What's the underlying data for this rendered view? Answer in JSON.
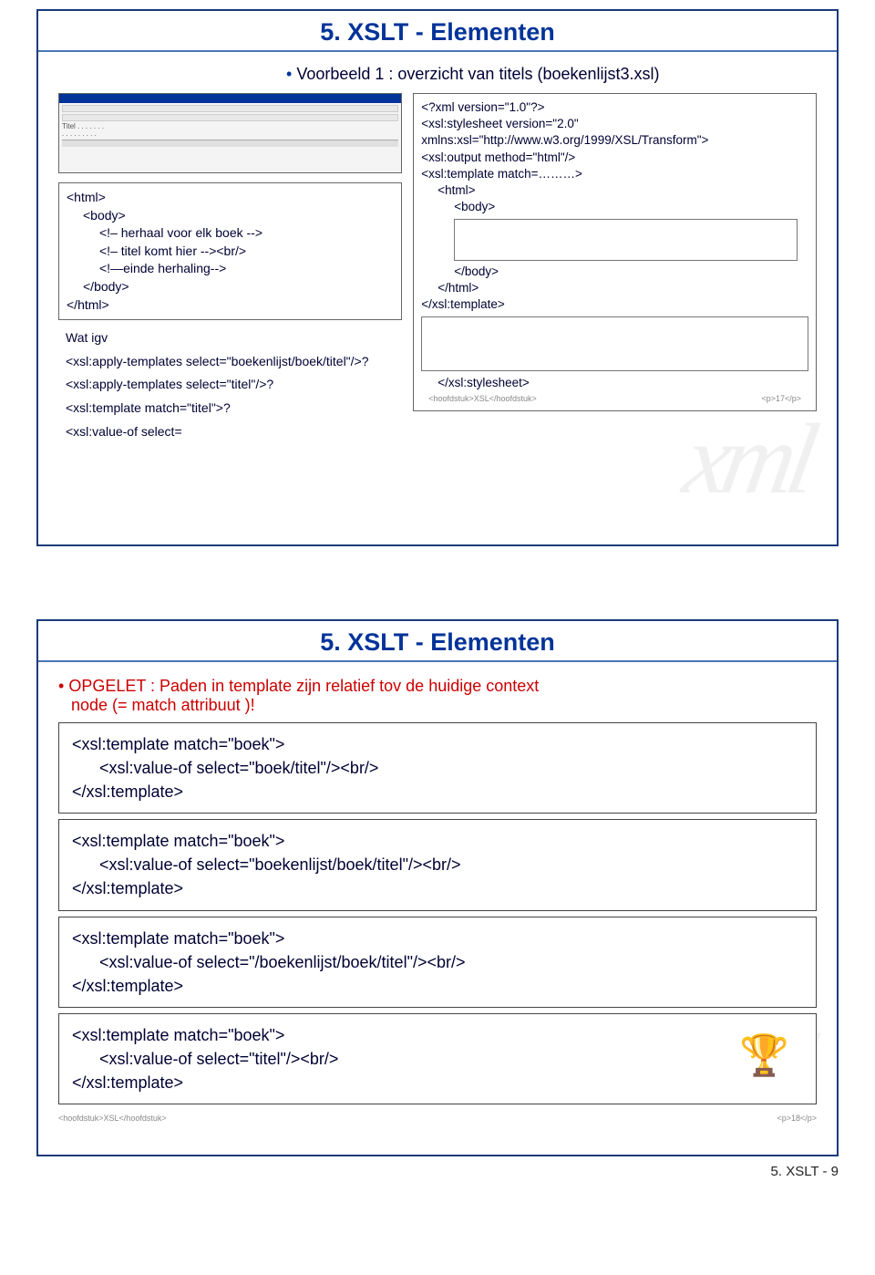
{
  "slide1": {
    "title": "5. XSLT - Elementen",
    "bullet": "Voorbeeld 1 : overzicht van titels (boekenlijst3.xsl)",
    "html_box": {
      "l1": "<html>",
      "l2": "<body>",
      "l3": "<!– herhaal voor elk boek -->",
      "l4": "<!– titel komt hier --><br/>",
      "l5": "<!—einde herhaling-->",
      "l6": "</body>",
      "l7": "</html>"
    },
    "wat_box": {
      "l1": "Wat igv",
      "l2": "<xsl:apply-templates select=\"boekenlijst/boek/titel\"/>?",
      "l3": "<xsl:apply-templates select=\"titel\"/>?",
      "l4": "<xsl:template match=\"titel\">?",
      "l5": "<xsl:value-of select="
    },
    "xsl": {
      "l1": "<?xml version=\"1.0\"?>",
      "l2": "<xsl:stylesheet version=\"2.0\" xmlns:xsl=\"http://www.w3.org/1999/XSL/Transform\">",
      "l3": "<xsl:output method=\"html\"/>",
      "l4": "<xsl:template match=………>",
      "l5": "<html>",
      "l6": "<body>",
      "l7": "</body>",
      "l8": "</html>",
      "l9": "</xsl:template>",
      "l10": "</xsl:stylesheet>"
    },
    "footer_left": "<hoofdstuk>XSL</hoofdstuk>",
    "footer_right": "<p>17</p>"
  },
  "slide2": {
    "title": "5. XSLT - Elementen",
    "warn1": "OPGELET : Paden in template zijn relatief tov de huidige context",
    "warn2": "node (= match attribuut )!",
    "block1": {
      "l1": "<xsl:template match=\"boek\">",
      "l2": "<xsl:value-of select=\"boek/titel\"/><br/>",
      "l3": "</xsl:template>"
    },
    "block2": {
      "l1": "<xsl:template match=\"boek\">",
      "l2": "<xsl:value-of select=\"boekenlijst/boek/titel\"/><br/>",
      "l3": "</xsl:template>"
    },
    "block3": {
      "l1": "<xsl:template match=\"boek\">",
      "l2": "<xsl:value-of select=\"/boekenlijst/boek/titel\"/><br/>",
      "l3": "</xsl:template>"
    },
    "block4": {
      "l1": "<xsl:template match=\"boek\">",
      "l2": "<xsl:value-of select=\"titel\"/><br/>",
      "l3": "</xsl:template>"
    },
    "footer_left": "<hoofdstuk>XSL</hoofdstuk>",
    "footer_right": "<p>18</p>"
  },
  "page_footer": "5. XSLT - 9"
}
